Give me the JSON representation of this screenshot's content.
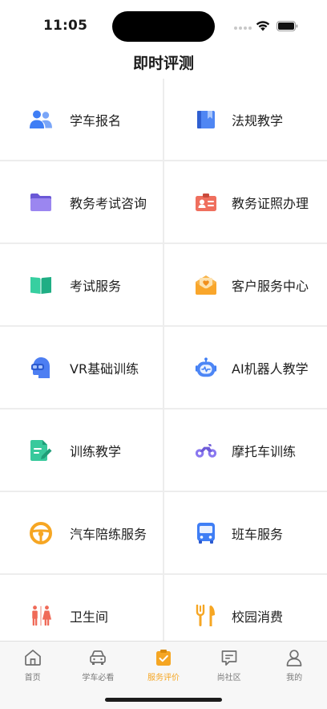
{
  "status": {
    "time": "11:05"
  },
  "header": {
    "title": "即时评测"
  },
  "colors": {
    "accent": "#f5a623",
    "blue": "#4d7ef2",
    "purple": "#8f7cf0",
    "red": "#f06b5a",
    "green": "#2fc99a",
    "orange": "#f7a93a"
  },
  "grid": {
    "items": [
      {
        "label": "学车报名",
        "icon": "users-icon"
      },
      {
        "label": "法规教学",
        "icon": "book-icon"
      },
      {
        "label": "教务考试咨询",
        "icon": "folder-icon"
      },
      {
        "label": "教务证照办理",
        "icon": "id-card-icon"
      },
      {
        "label": "考试服务",
        "icon": "open-book-icon"
      },
      {
        "label": "客户服务中心",
        "icon": "mail-heart-icon"
      },
      {
        "label": "VR基础训练",
        "icon": "vr-head-icon"
      },
      {
        "label": "AI机器人教学",
        "icon": "robot-icon"
      },
      {
        "label": "训练教学",
        "icon": "edit-document-icon"
      },
      {
        "label": "摩托车训练",
        "icon": "motorcycle-icon"
      },
      {
        "label": "汽车陪练服务",
        "icon": "steering-wheel-icon"
      },
      {
        "label": "班车服务",
        "icon": "bus-icon"
      },
      {
        "label": "卫生间",
        "icon": "restroom-icon"
      },
      {
        "label": "校园消费",
        "icon": "dining-icon"
      }
    ]
  },
  "tabbar": {
    "tabs": [
      {
        "label": "首页",
        "icon": "home-icon"
      },
      {
        "label": "学车必看",
        "icon": "car-icon"
      },
      {
        "label": "服务评价",
        "icon": "clipboard-check-icon",
        "active": true
      },
      {
        "label": "尚社区",
        "icon": "chat-icon"
      },
      {
        "label": "我的",
        "icon": "user-icon"
      }
    ]
  }
}
